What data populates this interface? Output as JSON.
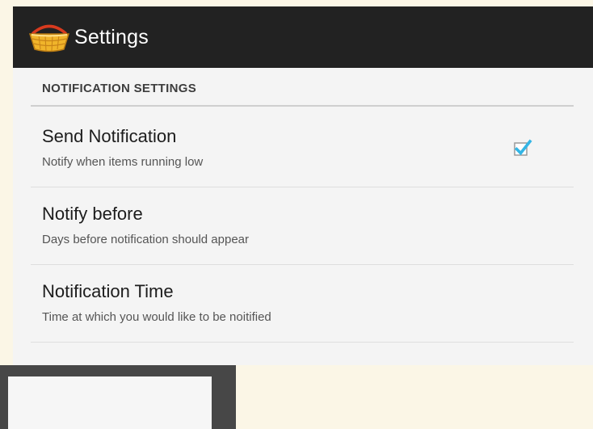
{
  "action_bar": {
    "title": "Settings",
    "icon": "basket-icon"
  },
  "section": {
    "header": "NOTIFICATION SETTINGS"
  },
  "preferences": [
    {
      "title": "Send Notification",
      "summary": "Notify when items running low",
      "checked": true
    },
    {
      "title": "Notify before",
      "summary": "Days before notification should appear"
    },
    {
      "title": "Notification Time",
      "summary": "Time at which you would like to be noitified"
    }
  ],
  "colors": {
    "action_bar": "#222222",
    "background": "#f4f4f4",
    "checkbox_accent": "#33b5e5"
  }
}
